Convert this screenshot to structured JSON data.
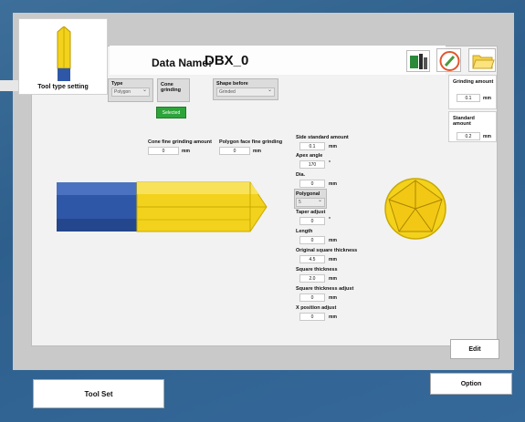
{
  "header": {
    "data_name_label": "Data Name:",
    "data_name_value": "DBX_0"
  },
  "tool_card": {
    "label": "Tool type setting"
  },
  "top_controls": {
    "type_label": "Type",
    "type_value": "Polygon",
    "cone_grinding_label": "Cone grinding",
    "selected_button": "Selected",
    "shape_before_label": "Shape before",
    "shape_before_value": "Grinded"
  },
  "finish": {
    "cone_label": "Cone fine grinding amount",
    "cone_value": "0",
    "cone_unit": "mm",
    "polygon_label": "Polygon face fine grinding",
    "polygon_value": "0",
    "polygon_unit": "mm"
  },
  "params": {
    "side_standard_label": "Side standard amount",
    "side_standard_value": "0.1",
    "side_standard_unit": "mm",
    "apex_label": "Apex angle",
    "apex_value": "170",
    "apex_unit": "°",
    "dia_label": "Dia.",
    "dia_value": "0",
    "dia_unit": "mm",
    "polygonal_label": "Polygonal",
    "polygonal_value": "5",
    "taper_label": "Taper adjust",
    "taper_value": "0",
    "taper_unit": "°",
    "length_label": "Length",
    "length_value": "0",
    "length_unit": "mm",
    "orig_square_label": "Original square thickness",
    "orig_square_value": "4.5",
    "orig_square_unit": "mm",
    "square_label": "Square thickness",
    "square_value": "2.0",
    "square_unit": "mm",
    "square_adj_label": "Square thickness adjust",
    "square_adj_value": "0",
    "square_adj_unit": "mm",
    "xpos_label": "X position adjust",
    "xpos_value": "0",
    "xpos_unit": "mm"
  },
  "right_panel": {
    "grinding_label": "Grinding amount",
    "grinding_value": "0.1",
    "grinding_unit": "mm",
    "standard_label": "Standard amount",
    "standard_value": "0.2",
    "standard_unit": "mm"
  },
  "buttons": {
    "edit": "Edit",
    "tool_set": "Tool Set",
    "option": "Option"
  },
  "icons": {
    "tool_icon": "tool-library-icon",
    "edit_icon": "pencil-icon",
    "folder_icon": "folder-icon"
  },
  "colors": {
    "green": "#2da43a",
    "tool_blue": "#2f57a8",
    "tool_gold": "#f0d020"
  }
}
